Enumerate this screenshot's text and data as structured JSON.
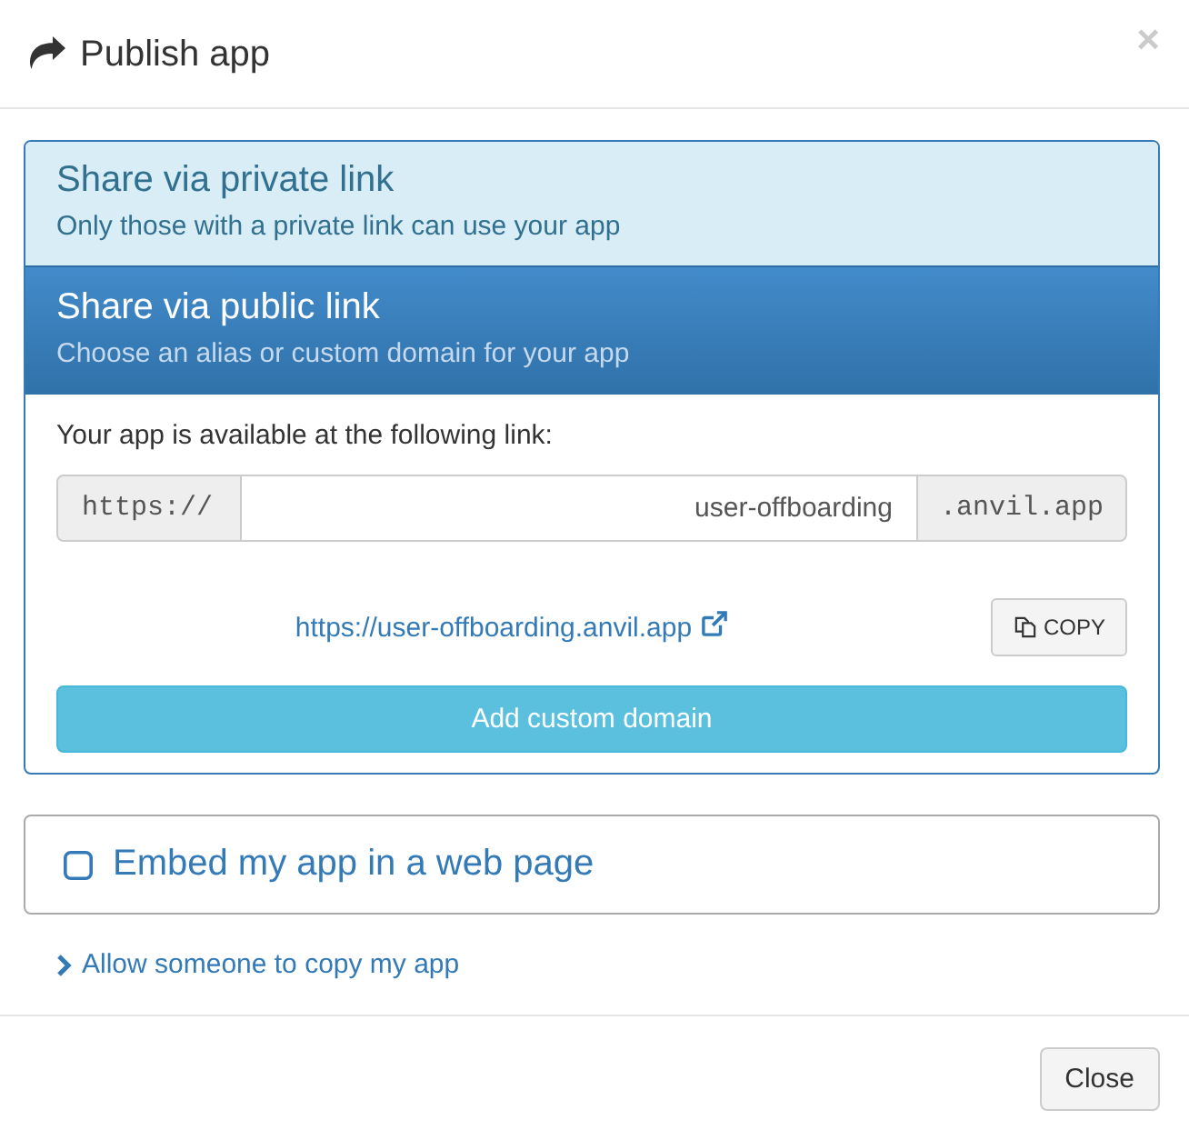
{
  "dialog": {
    "title": "Publish app",
    "close_symbol": "×"
  },
  "share_options": [
    {
      "title": "Share via private link",
      "subtitle": "Only those with a private link can use your app",
      "selected": false
    },
    {
      "title": "Share via public link",
      "subtitle": "Choose an alias or custom domain for your app",
      "selected": true
    }
  ],
  "public_link": {
    "intro": "Your app is available at the following link:",
    "prefix": "https://",
    "alias": "user-offboarding",
    "suffix": ".anvil.app",
    "url": "https://user-offboarding.anvil.app",
    "copy_button": "COPY",
    "custom_domain_button": "Add custom domain"
  },
  "embed": {
    "label": "Embed my app in a web page",
    "checked": false
  },
  "copy_access": {
    "label": "Allow someone to copy my app",
    "expanded": false
  },
  "footer": {
    "buttons": [
      "Close"
    ]
  }
}
